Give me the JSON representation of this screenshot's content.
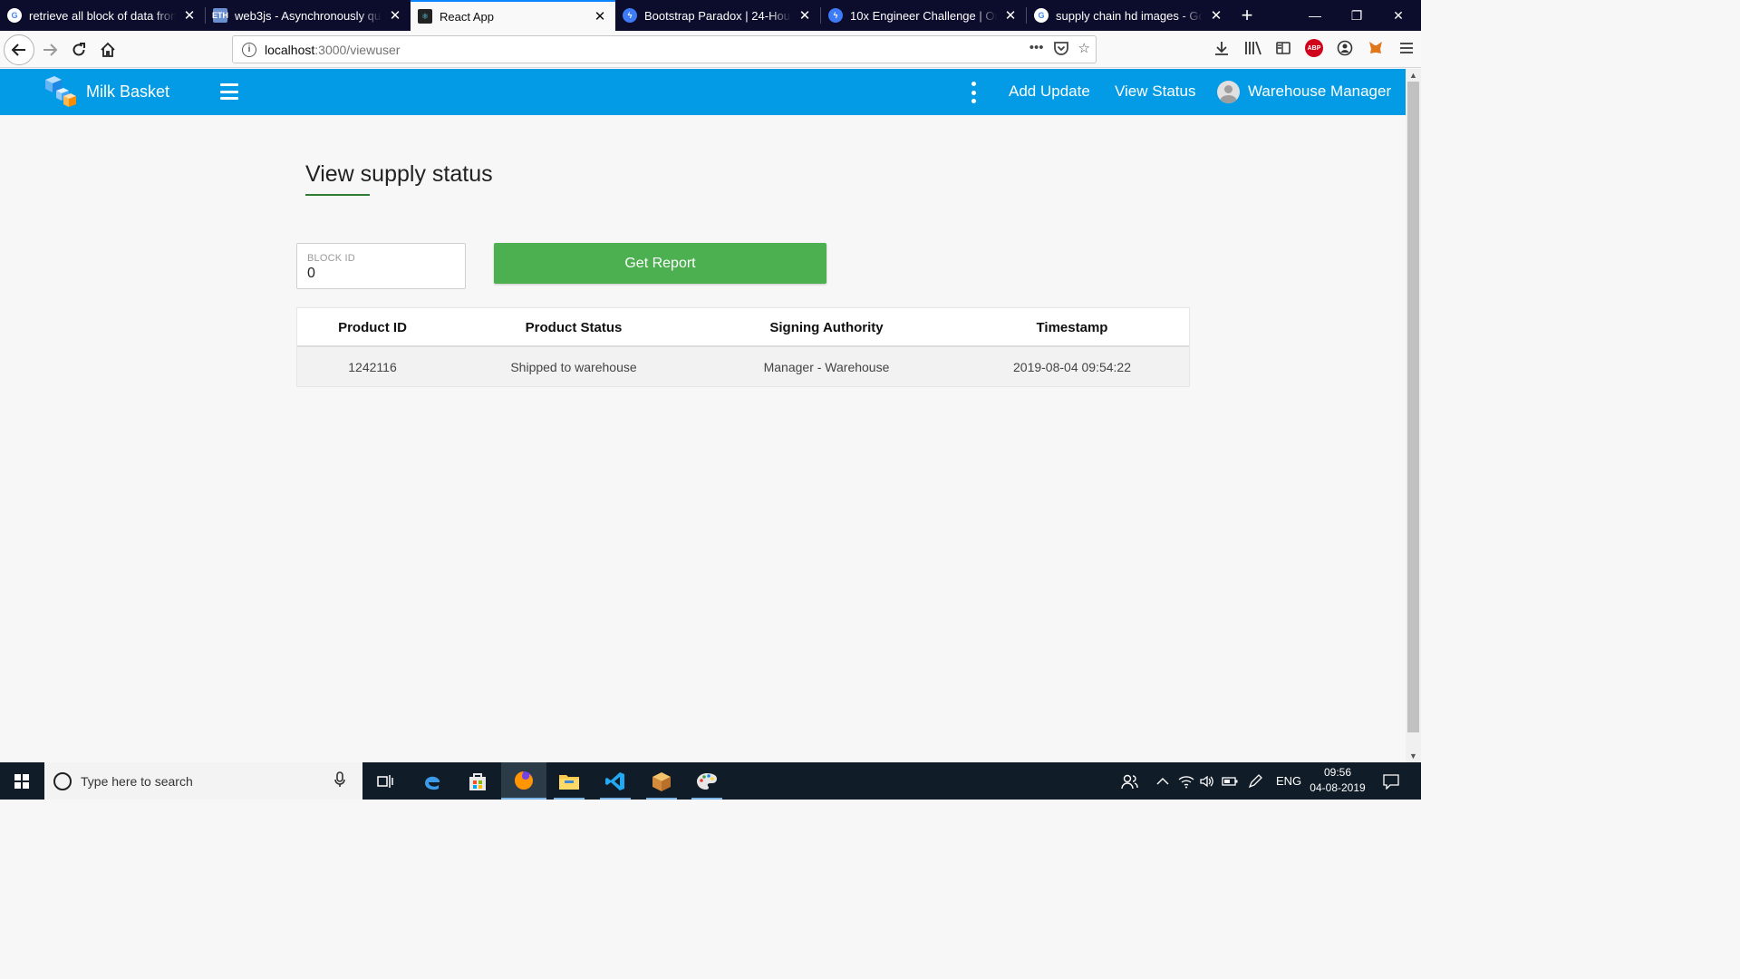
{
  "browser": {
    "tabs": [
      {
        "title": "retrieve all block of data from",
        "favicon": "google-icon",
        "active": false
      },
      {
        "title": "web3js - Asynchronously query",
        "favicon": "eth-icon",
        "active": false
      },
      {
        "title": "React App",
        "favicon": "react-icon",
        "active": true
      },
      {
        "title": "Bootstrap Paradox | 24-Hour H",
        "favicon": "bolt-icon",
        "active": false
      },
      {
        "title": "10x Engineer Challenge | Onlin",
        "favicon": "bolt-icon",
        "active": false
      },
      {
        "title": "supply chain hd images - Goo",
        "favicon": "google-icon",
        "active": false
      }
    ],
    "url_host": "localhost",
    "url_path": ":3000/viewuser"
  },
  "app": {
    "brand": "Milk Basket",
    "nav": {
      "add_update": "Add Update",
      "view_status": "View Status",
      "user_role": "Warehouse Manager"
    },
    "accent_color": "#039be5"
  },
  "page": {
    "title": "View supply status",
    "block_id_label": "BLOCK ID",
    "block_id_value": "0",
    "get_report_label": "Get Report",
    "button_color": "#4caf50"
  },
  "table": {
    "headers": [
      "Product ID",
      "Product Status",
      "Signing Authority",
      "Timestamp"
    ],
    "rows": [
      [
        "1242116",
        "Shipped to warehouse",
        "Manager - Warehouse",
        "2019-08-04 09:54:22"
      ]
    ]
  },
  "taskbar": {
    "search_placeholder": "Type here to search",
    "language": "ENG",
    "time": "09:56",
    "date": "04-08-2019"
  }
}
